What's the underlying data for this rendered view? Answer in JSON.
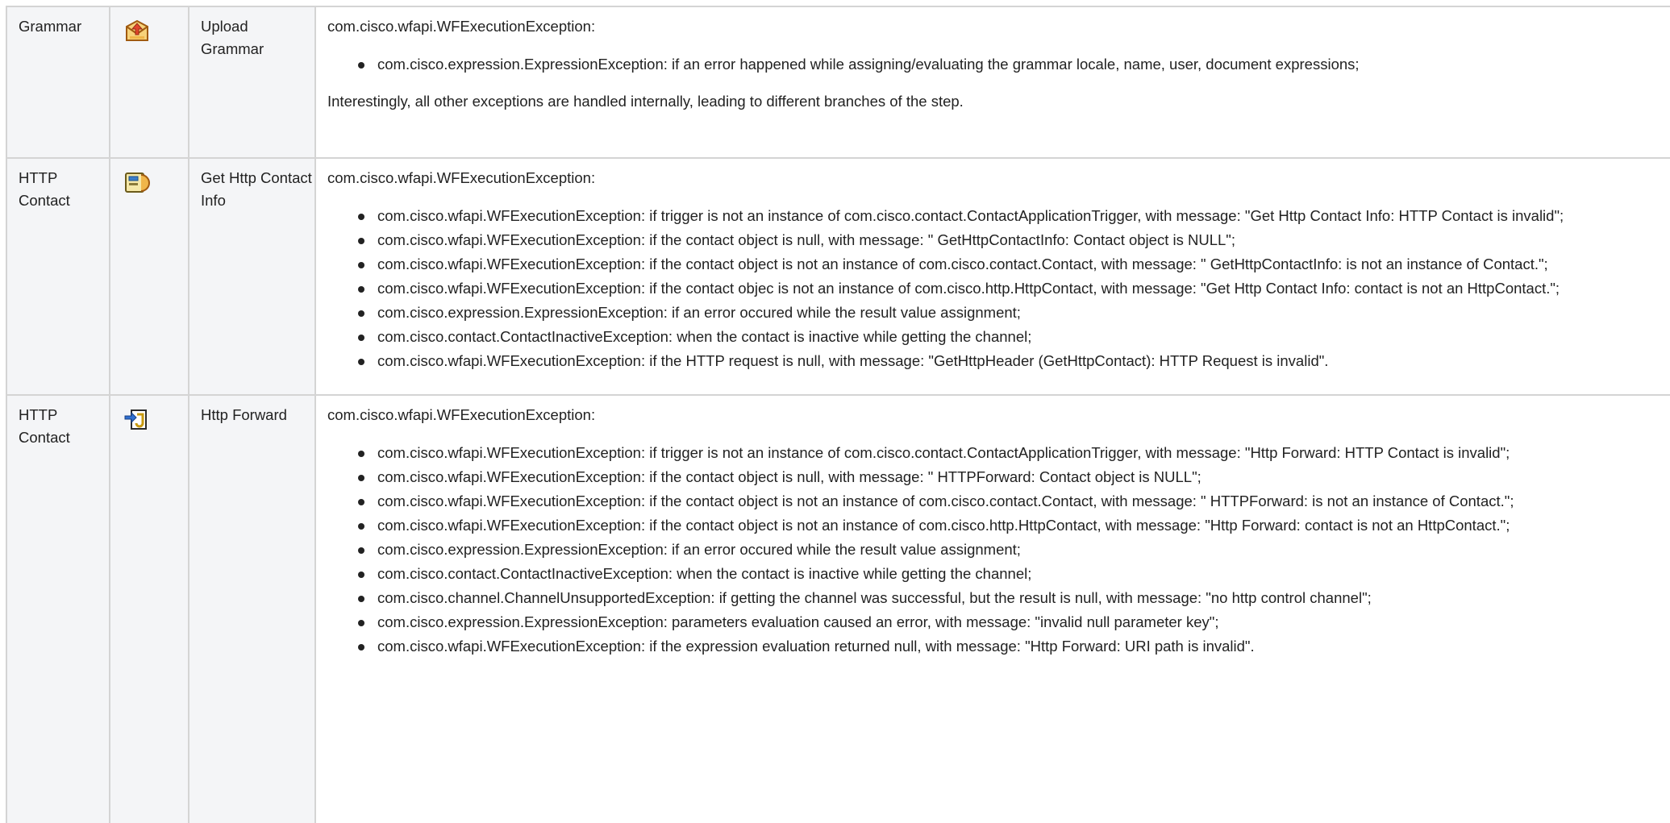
{
  "rows": [
    {
      "category": "Grammar",
      "icon": "upload-grammar-icon",
      "step": "Upload Grammar",
      "intro": "com.cisco.wfapi.WFExecutionException:",
      "items": [
        "com.cisco.expression.ExpressionException: if an error happened while assigning/evaluating the grammar locale, name, user, document expressions;"
      ],
      "outro": "Interestingly, all other exceptions are handled internally, leading to different branches of the step."
    },
    {
      "category": "HTTP Contact",
      "icon": "get-http-contact-info-icon",
      "step": "Get Http Contact Info",
      "intro": "com.cisco.wfapi.WFExecutionException:",
      "items": [
        "com.cisco.wfapi.WFExecutionException: if trigger is not an instance of com.cisco.contact.ContactApplicationTrigger, with message: \"Get Http Contact Info: HTTP Contact is invalid\";",
        "com.cisco.wfapi.WFExecutionException: if the contact object is null, with message: \" GetHttpContactInfo: Contact object is NULL\";",
        "com.cisco.wfapi.WFExecutionException: if the contact object is not an instance of com.cisco.contact.Contact, with message: \" GetHttpContactInfo: is not an instance of Contact.\";",
        "com.cisco.wfapi.WFExecutionException: if the contact objec is not an instance of com.cisco.http.HttpContact, with message: \"Get Http Contact Info: contact is not an HttpContact.\";",
        "com.cisco.expression.ExpressionException: if an error occured while the result value assignment;",
        "com.cisco.contact.ContactInactiveException: when the contact is inactive while getting the channel;",
        "com.cisco.wfapi.WFExecutionException: if the HTTP request is null, with message: \"GetHttpHeader (GetHttpContact): HTTP Request is invalid\"."
      ]
    },
    {
      "category": "HTTP Contact",
      "icon": "http-forward-icon",
      "step": "Http Forward",
      "intro": "com.cisco.wfapi.WFExecutionException:",
      "items": [
        "com.cisco.wfapi.WFExecutionException: if trigger is not an instance of com.cisco.contact.ContactApplicationTrigger, with message: \"Http Forward: HTTP Contact is invalid\";",
        "com.cisco.wfapi.WFExecutionException: if the contact object is null, with message: \" HTTPForward: Contact object is NULL\";",
        "com.cisco.wfapi.WFExecutionException: if the contact object is not an instance of com.cisco.contact.Contact, with message: \" HTTPForward: is not an instance of Contact.\";",
        "com.cisco.wfapi.WFExecutionException: if the contact object is not an instance of com.cisco.http.HttpContact, with message: \"Http Forward: contact is not an HttpContact.\";",
        "com.cisco.expression.ExpressionException: if an error occured while the result value assignment;",
        "com.cisco.contact.ContactInactiveException: when the contact is inactive while getting the channel;",
        "com.cisco.channel.ChannelUnsupportedException: if getting the channel was successful, but the result is null, with message: \"no http control channel\";",
        "com.cisco.expression.ExpressionException: parameters evaluation caused an error, with message: \"invalid null parameter key\";",
        "com.cisco.wfapi.WFExecutionException: if the expression evaluation returned null, with message: \"Http Forward: URI path is invalid\"."
      ]
    }
  ]
}
